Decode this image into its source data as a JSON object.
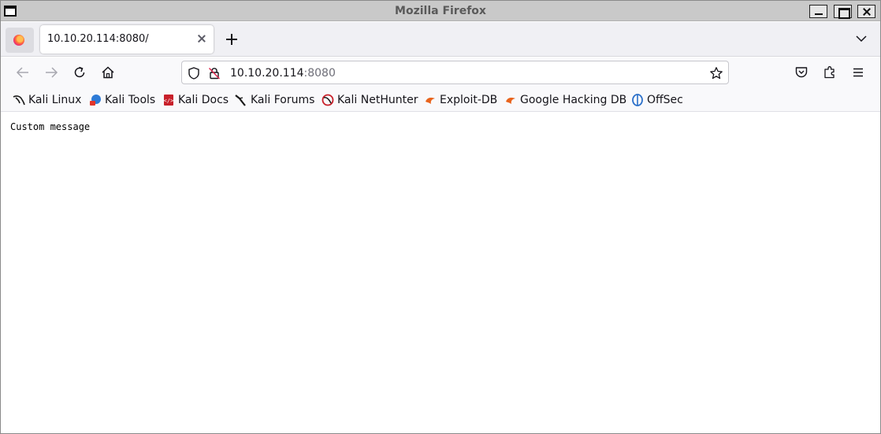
{
  "window": {
    "title": "Mozilla Firefox"
  },
  "tabs": [
    {
      "title": "10.10.20.114:8080/",
      "active": true
    }
  ],
  "urlbar": {
    "host": "10.10.20.114",
    "port": ":8080"
  },
  "bookmarks": [
    {
      "label": "Kali Linux",
      "icon": "kali-dragon-icon"
    },
    {
      "label": "Kali Tools",
      "icon": "kali-tools-icon"
    },
    {
      "label": "Kali Docs",
      "icon": "kali-docs-icon"
    },
    {
      "label": "Kali Forums",
      "icon": "kali-forums-icon"
    },
    {
      "label": "Kali NetHunter",
      "icon": "nethunter-icon"
    },
    {
      "label": "Exploit-DB",
      "icon": "exploit-db-icon"
    },
    {
      "label": "Google Hacking DB",
      "icon": "ghdb-icon"
    },
    {
      "label": "OffSec",
      "icon": "offsec-icon"
    }
  ],
  "page": {
    "body_text": "Custom message"
  },
  "colors": {
    "titlebar": "#c9c9c9",
    "tabstrip": "#f0f0f4",
    "toolbar": "#f9f9fb"
  }
}
